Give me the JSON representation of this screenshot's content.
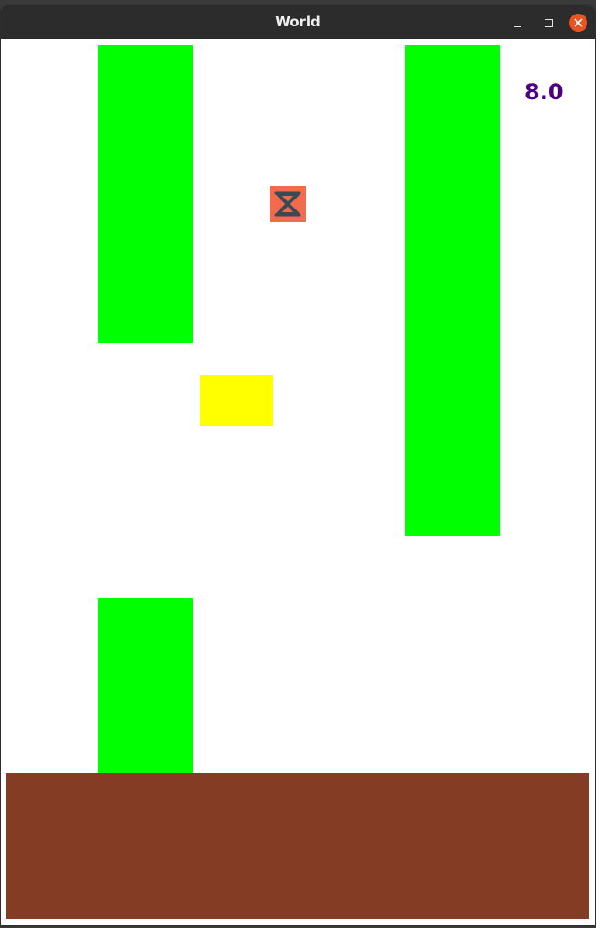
{
  "window": {
    "title": "World"
  },
  "game": {
    "score": "8.0",
    "colors": {
      "pipe": "#00ff00",
      "ground": "#843c24",
      "bird": "#ffff00",
      "score": "#4b0082",
      "background": "#ffffff",
      "hourglass_bg": "#f26b4f",
      "close_button": "#e95420"
    },
    "icons": {
      "hourglass": "hourglass-icon",
      "close": "close-icon",
      "minimize": "minimize-icon",
      "maximize": "maximize-icon"
    }
  }
}
